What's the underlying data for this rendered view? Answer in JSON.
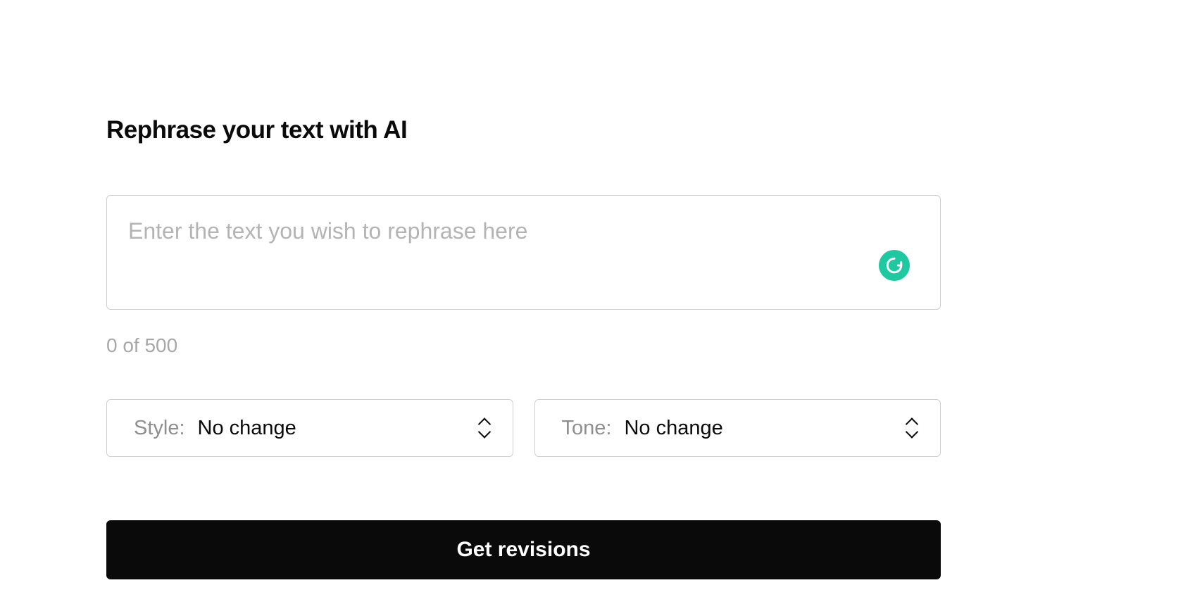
{
  "heading": "Rephrase your text with AI",
  "textarea": {
    "placeholder": "Enter the text you wish to rephrase here",
    "value": ""
  },
  "counter": "0 of 500",
  "style_select": {
    "label": "Style:",
    "value": "No change"
  },
  "tone_select": {
    "label": "Tone:",
    "value": "No change"
  },
  "submit_label": "Get revisions"
}
